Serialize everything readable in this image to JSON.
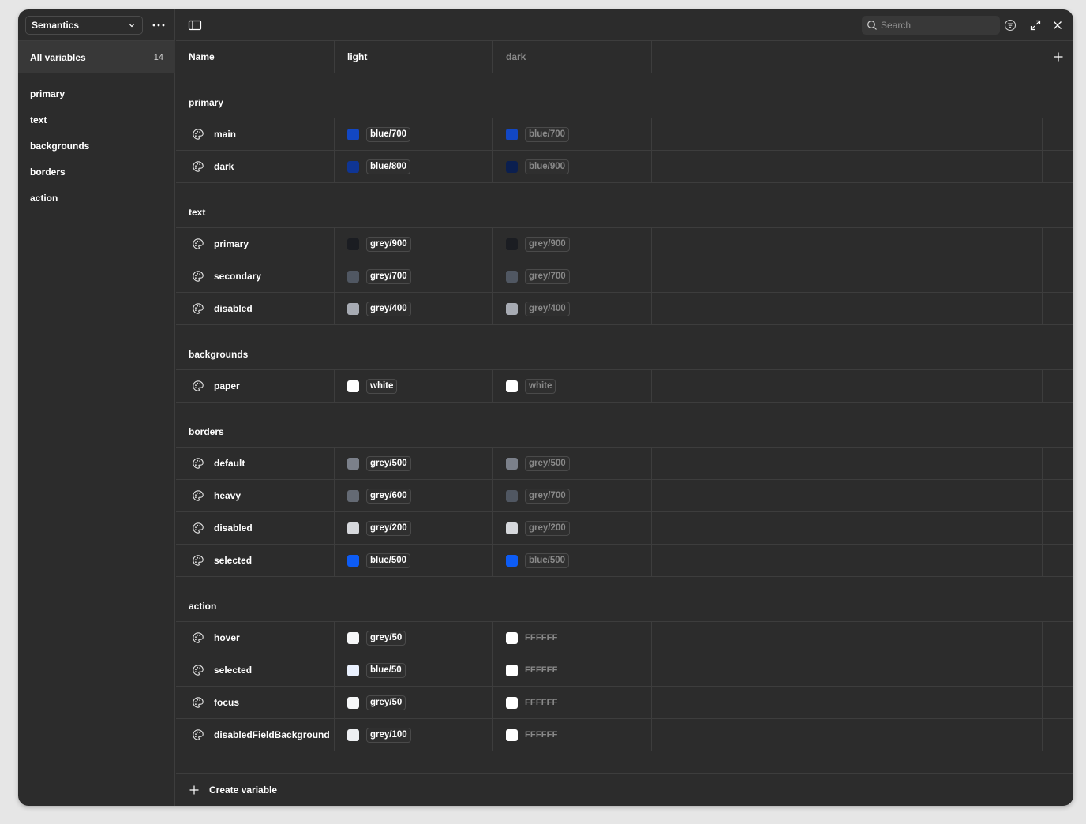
{
  "collection": {
    "name": "Semantics"
  },
  "sidebar": {
    "all_label": "All variables",
    "all_count": "14",
    "groups": [
      "primary",
      "text",
      "backgrounds",
      "borders",
      "action"
    ]
  },
  "search": {
    "placeholder": "Search"
  },
  "columns": {
    "name": "Name",
    "light": "light",
    "dark": "dark"
  },
  "colors": {
    "window_bg": "#2c2c2c",
    "divider": "#3d3d3d",
    "accent_blue": "#0d5cf5"
  },
  "table": {
    "groups": [
      {
        "name": "primary",
        "rows": [
          {
            "name": "main",
            "light": {
              "label": "blue/700",
              "color": "#1247c4"
            },
            "dark": {
              "label": "blue/700",
              "color": "#1247c4"
            }
          },
          {
            "name": "dark",
            "light": {
              "label": "blue/800",
              "color": "#0f3594"
            },
            "dark": {
              "label": "blue/900",
              "color": "#0b1f4f"
            }
          }
        ]
      },
      {
        "name": "text",
        "rows": [
          {
            "name": "primary",
            "light": {
              "label": "grey/900",
              "color": "#1b1d22"
            },
            "dark": {
              "label": "grey/900",
              "color": "#1b1d22"
            }
          },
          {
            "name": "secondary",
            "light": {
              "label": "grey/700",
              "color": "#505762"
            },
            "dark": {
              "label": "grey/700",
              "color": "#505762"
            }
          },
          {
            "name": "disabled",
            "light": {
              "label": "grey/400",
              "color": "#a7abb3"
            },
            "dark": {
              "label": "grey/400",
              "color": "#a7abb3"
            }
          }
        ]
      },
      {
        "name": "backgrounds",
        "rows": [
          {
            "name": "paper",
            "light": {
              "label": "white",
              "color": "#ffffff"
            },
            "dark": {
              "label": "white",
              "color": "#ffffff"
            }
          }
        ]
      },
      {
        "name": "borders",
        "rows": [
          {
            "name": "default",
            "light": {
              "label": "grey/500",
              "color": "#7b808a"
            },
            "dark": {
              "label": "grey/500",
              "color": "#7b808a"
            }
          },
          {
            "name": "heavy",
            "light": {
              "label": "grey/600",
              "color": "#646a74"
            },
            "dark": {
              "label": "grey/700",
              "color": "#505762"
            }
          },
          {
            "name": "disabled",
            "light": {
              "label": "grey/200",
              "color": "#d6d8dc"
            },
            "dark": {
              "label": "grey/200",
              "color": "#d6d8dc"
            }
          },
          {
            "name": "selected",
            "light": {
              "label": "blue/500",
              "color": "#0d5cf5"
            },
            "dark": {
              "label": "blue/500",
              "color": "#0d5cf5"
            }
          }
        ]
      },
      {
        "name": "action",
        "rows": [
          {
            "name": "hover",
            "light": {
              "label": "grey/50",
              "color": "#f6f7f8"
            },
            "dark": {
              "label": "FFFFFF",
              "color": "#ffffff",
              "raw": true
            }
          },
          {
            "name": "selected",
            "light": {
              "label": "blue/50",
              "color": "#eaf1fe"
            },
            "dark": {
              "label": "FFFFFF",
              "color": "#ffffff",
              "raw": true
            }
          },
          {
            "name": "focus",
            "light": {
              "label": "grey/50",
              "color": "#f6f7f8"
            },
            "dark": {
              "label": "FFFFFF",
              "color": "#ffffff",
              "raw": true
            }
          },
          {
            "name": "disabledFieldBackground",
            "light": {
              "label": "grey/100",
              "color": "#eef0f2"
            },
            "dark": {
              "label": "FFFFFF",
              "color": "#ffffff",
              "raw": true
            }
          }
        ]
      }
    ]
  },
  "footer": {
    "create_label": "Create variable"
  }
}
